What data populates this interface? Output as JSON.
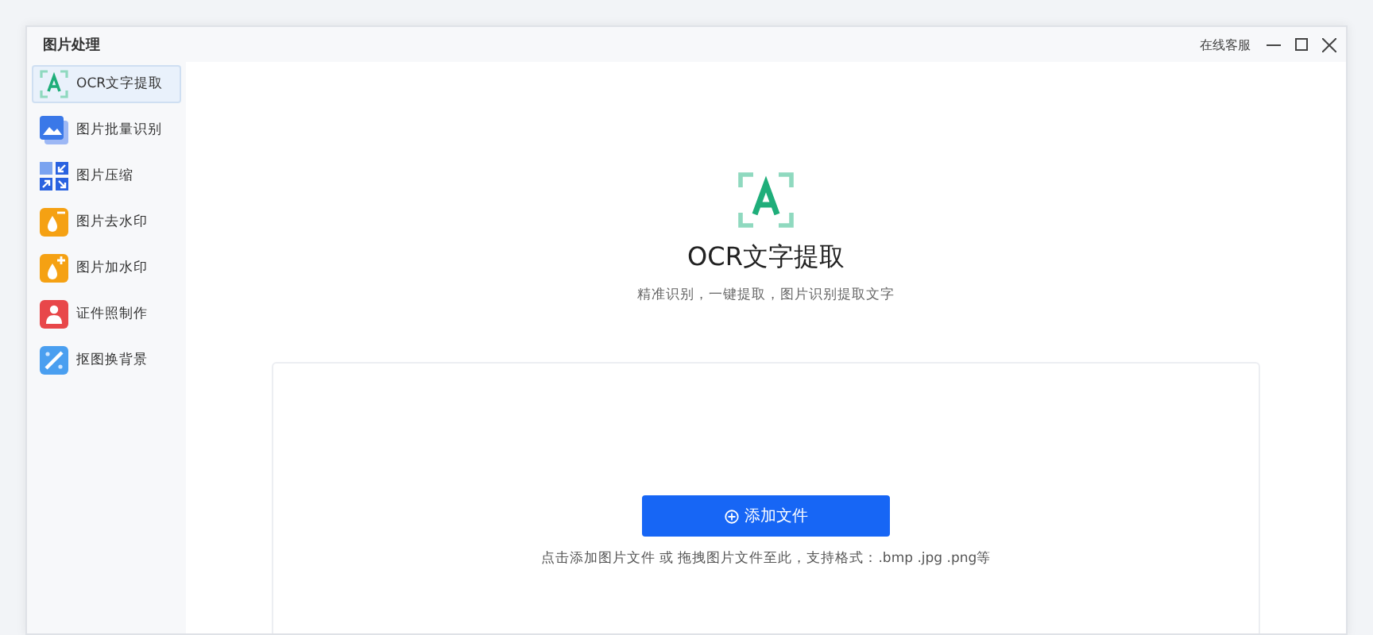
{
  "window": {
    "title": "图片处理",
    "support_link": "在线客服"
  },
  "sidebar": {
    "items": [
      {
        "label": "OCR文字提取",
        "selected": true
      },
      {
        "label": "图片批量识别",
        "selected": false
      },
      {
        "label": "图片压缩",
        "selected": false
      },
      {
        "label": "图片去水印",
        "selected": false
      },
      {
        "label": "图片加水印",
        "selected": false
      },
      {
        "label": "证件照制作",
        "selected": false
      },
      {
        "label": "抠图换背景",
        "selected": false
      }
    ]
  },
  "main": {
    "title": "OCR文字提取",
    "subtitle": "精准识别，一键提取，图片识别提取文字",
    "add_button": "添加文件",
    "hint": "点击添加图片文件 或 拖拽图片文件至此，支持格式：.bmp .jpg .png等"
  }
}
